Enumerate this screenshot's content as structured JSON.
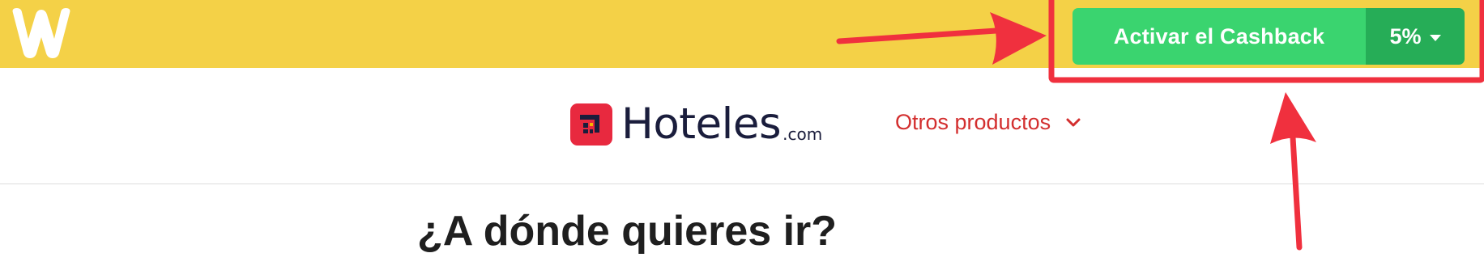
{
  "extension": {
    "logo_icon": "w-logo-icon",
    "bar_color": "#f4d147",
    "cashback_label": "Activar el Cashback",
    "cashback_rate": "5%",
    "cashback_color": "#3ad46f",
    "cashback_rate_color": "#26ad57"
  },
  "site": {
    "brand_name": "Hoteles",
    "brand_tld": ".com",
    "brand_color": "#e8293f",
    "nav_other_products": "Otros productos",
    "headline": "¿A dónde quieres ir?"
  },
  "annotations": {
    "color": "#f0303e",
    "highlight": "cashback-button",
    "arrows": [
      "arrow-right",
      "arrow-up"
    ]
  }
}
